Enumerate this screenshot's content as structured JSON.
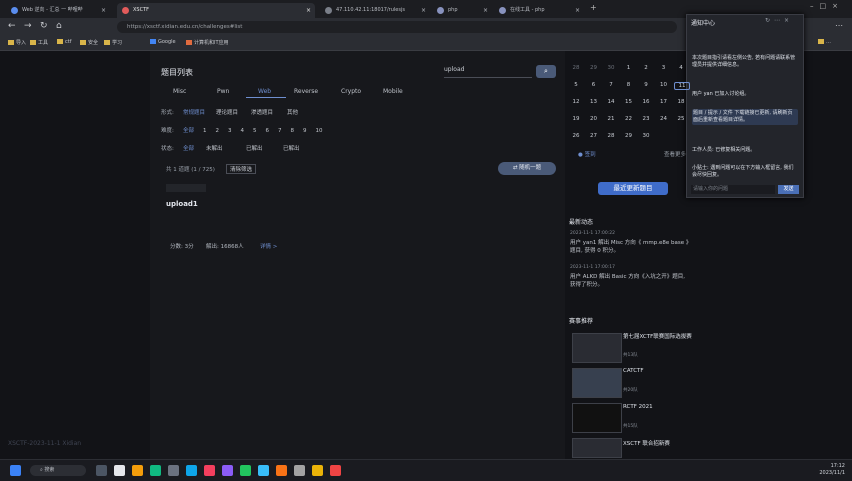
{
  "tabs": [
    {
      "label": "Web 逆向 - 汇总 一 哔哩哔"
    },
    {
      "label": "XSCTF"
    },
    {
      "label": "47.110.42.11:18017/rulesjs"
    },
    {
      "label": "php"
    },
    {
      "label": "在线工具 - php"
    }
  ],
  "address": {
    "url": "https://xsctf.xidian.edu.cn/challenges#list"
  },
  "bookmarks": [
    "导入",
    "工具",
    "ctf",
    "安全",
    "学习",
    "Google",
    "计算机和IT应用"
  ],
  "page": {
    "section_title": "题目列表",
    "search_value": "upload",
    "categories": [
      "Misc",
      "Pwn",
      "Web",
      "Reverse",
      "Crypto",
      "Mobile"
    ],
    "filter_label": "形式:",
    "filters": [
      "常规题目",
      "理论题目",
      "渗透题目",
      "其他"
    ],
    "diff_label": "难度:",
    "diff_values": [
      "全部",
      "1",
      "2",
      "3",
      "4",
      "5",
      "6",
      "7",
      "8",
      "9",
      "10"
    ],
    "status_label": "状态:",
    "status_values": [
      "全部",
      "未解出",
      "已解出",
      "已解出"
    ],
    "result_summary": "共 1 道题 (1 / 725)",
    "clear_label": "清除筛选",
    "random_label": "随机一题",
    "challenge_name": "upload1",
    "stats": {
      "score": "分数: 3分",
      "solves": "解出: 16868人",
      "detail_link": "详情 >"
    }
  },
  "calendar": {
    "rows": [
      [
        "28",
        "29",
        "30",
        "1",
        "2",
        "3",
        "4"
      ],
      [
        "5",
        "6",
        "7",
        "8",
        "9",
        "10",
        "11"
      ],
      [
        "12",
        "13",
        "14",
        "15",
        "16",
        "17",
        "18"
      ],
      [
        "19",
        "20",
        "21",
        "22",
        "23",
        "24",
        "25"
      ],
      [
        "26",
        "27",
        "28",
        "29",
        "30",
        "",
        ""
      ]
    ],
    "legend": "签到",
    "action": "查看更多"
  },
  "banner_label": "最近更新题目",
  "activity": {
    "title": "最新动态",
    "items": [
      {
        "time": "2023-11-1 17:00:22",
        "text": "用户 yan1 解出 Misc 方向《 mmp.e8e base 》题目, 获得 0 积分。"
      },
      {
        "time": "2023-11-1 17:00:17",
        "text": "用户 ALKD 解出 Basic 方向《入坑之开》题目, 获得了积分。"
      }
    ]
  },
  "events": {
    "title": "赛事推荐",
    "items": [
      {
        "name": "第七届XCTF联赛国际选拔赛",
        "host": "共13队"
      },
      {
        "name": "CATCTF",
        "host": "共20队"
      },
      {
        "name": "RCTF 2021",
        "host": "共15队"
      },
      {
        "name": "XSCTF 联合招新赛",
        "host": "共20队"
      }
    ]
  },
  "chat": {
    "title": "通知中心",
    "messages": [
      "本次题目指引请看左侧公告, 若有问题请联系管理员并提供详细信息。",
      "用户 yan 已加入讨论组。",
      "题目 / 提示 / 文件 下载链接已更新, 请刷新页面后重新查看题目详情。",
      "工作人员: 已修复相关问题。",
      "小贴士: 遇到问题可以在下方输入框留言, 我们会尽快回复。"
    ],
    "input_placeholder": "请输入你的问题",
    "send_label": "发送"
  },
  "watermark": "XSCTF-2023-11-1 Xidian",
  "taskbar": {
    "search": "搜索",
    "time": "17:12",
    "date": "2023/11/1"
  },
  "colors": {
    "accent": "#4a5a78",
    "active_cat": "#6f8fd0",
    "banner": "#3f6cc9"
  }
}
